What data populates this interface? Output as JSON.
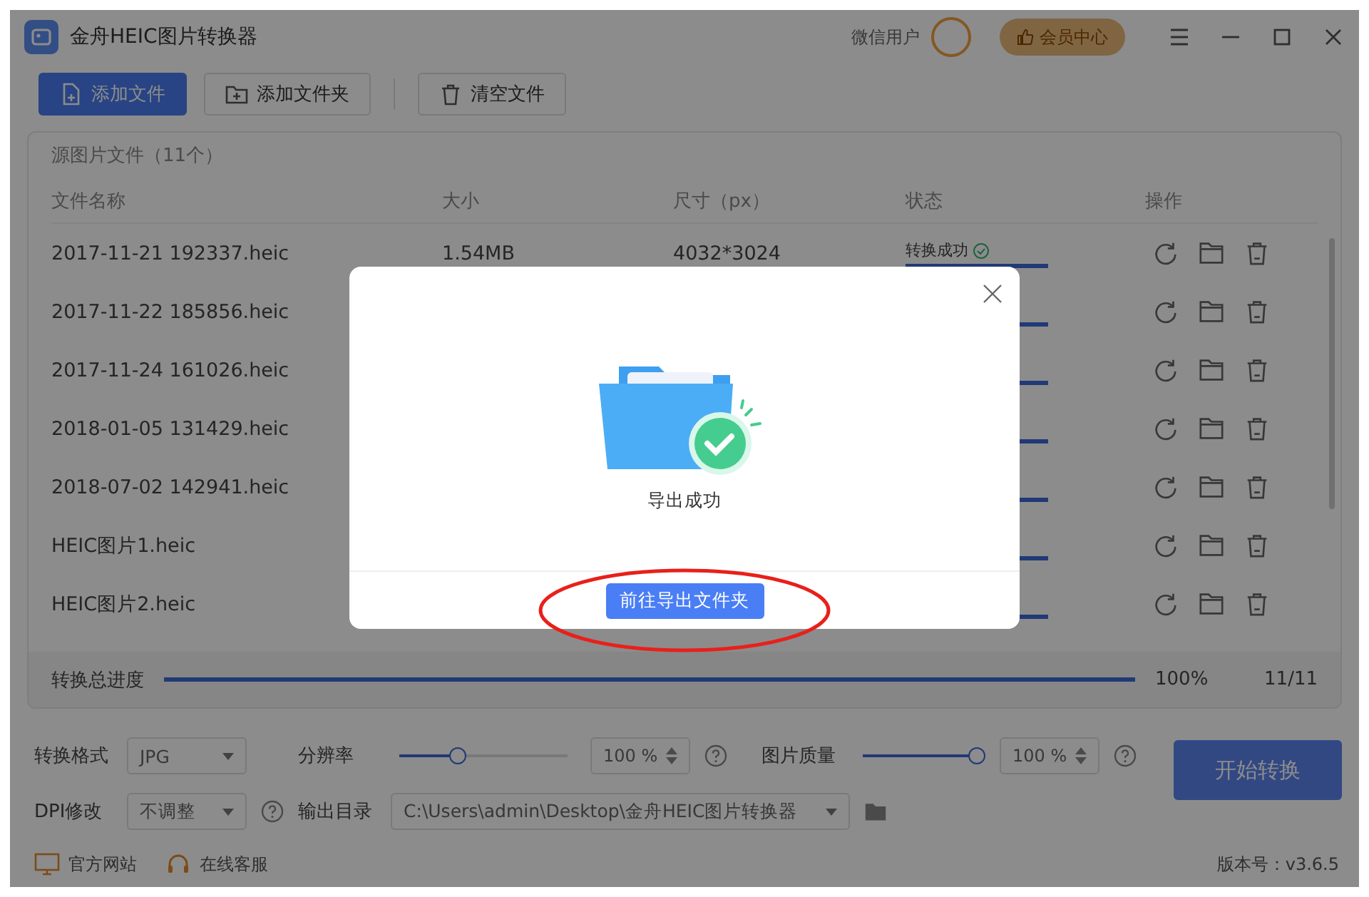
{
  "window": {
    "title": "金舟HEIC图片转换器",
    "user_name": "微信用户",
    "member_button": "会员中心"
  },
  "toolbar": [
    {
      "label": "添加文件",
      "kind": "primary"
    },
    {
      "label": "添加文件夹",
      "kind": "folder"
    },
    {
      "label": "清空文件",
      "kind": "clear"
    }
  ],
  "file_panel": {
    "title": "源图片文件（11个）",
    "columns": [
      "文件名称",
      "大小",
      "尺寸（px）",
      "状态",
      "操作"
    ],
    "rows": [
      {
        "name": "2017-11-21 192337.heic",
        "size": "1.54MB",
        "dimensions": "4032*3024",
        "status": "转换成功",
        "level": 1
      },
      {
        "name": "2017-11-22 185856.heic",
        "level": 1
      },
      {
        "name": "2017-11-24 161026.heic",
        "level": 1
      },
      {
        "name": "2018-01-05 131429.heic",
        "level": 1
      },
      {
        "name": "2018-07-02 142941.heic",
        "level": 1
      },
      {
        "name": "HEIC图片1.heic",
        "level": 1
      },
      {
        "name": "HEIC图片2.heic",
        "level": 1
      }
    ]
  },
  "progress": {
    "label": "转换总进度",
    "level": 1,
    "percent": "100%",
    "count": "11/11"
  },
  "settings": {
    "format": {
      "label": "转换格式",
      "value": "JPG"
    },
    "resolution": {
      "label": "分辨率",
      "level": 0.35,
      "value": "100 %"
    },
    "quality": {
      "label": "图片质量",
      "level": 1,
      "value": "100 %"
    },
    "dpi": {
      "label": "DPI修改",
      "value": "不调整"
    },
    "output": {
      "label": "输出目录",
      "value": "C:\\Users\\admin\\Desktop\\金舟HEIC图片转换器"
    },
    "start_button": "开始转换"
  },
  "footer": {
    "links": [
      "官方网站",
      "在线客服"
    ],
    "version": "版本号：v3.6.5"
  },
  "dialog": {
    "message": "导出成功",
    "button": "前往导出文件夹"
  }
}
